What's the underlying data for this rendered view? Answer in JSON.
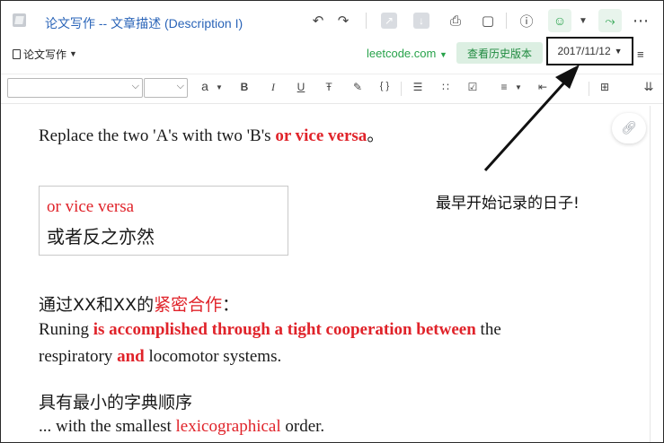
{
  "titlebar": {
    "title": "论文写作 -- 文章描述 (Description I)",
    "icons": [
      "undo-icon",
      "redo-icon",
      "pdf-export-icon",
      "download-icon",
      "print-icon",
      "present-icon",
      "info-icon",
      "user-add-icon",
      "dropdown-icon",
      "share-icon",
      "more-icon"
    ]
  },
  "row2": {
    "notebook_label": "论文写作",
    "site_label": "leetcode.com",
    "history_label": "查看历史版本",
    "date_value": "2017/11/12"
  },
  "format": {
    "font_size_glyph": "a",
    "bold": "B",
    "italic": "I",
    "underline": "U",
    "strike": "Ŧ",
    "code": "{ }"
  },
  "content": {
    "line1_a": "Replace the two 'A's with two 'B's ",
    "line1_b": "or vice versa",
    "line1_c": "。",
    "quote_en": "or vice versa",
    "quote_zh": "或者反之亦然",
    "h1_a": "通过XX和XX的",
    "h1_b": "紧密合作",
    "h1_c": "：",
    "p1_a": "Runing ",
    "p1_b": "is accomplished through a tight cooperation between",
    "p1_c": " the",
    "p2_a": "respiratory ",
    "p2_b": "and",
    "p2_c": " locomotor systems.",
    "h2": "具有最小的字典顺序",
    "p3_a": "... with the smallest ",
    "p3_b": "lexicographical",
    "p3_c": " order."
  },
  "annotation": {
    "text": "最早开始记录的日子!"
  },
  "colors": {
    "accent_green": "#27a24a",
    "title_blue": "#2a64b8",
    "highlight_red": "#e0232a"
  }
}
